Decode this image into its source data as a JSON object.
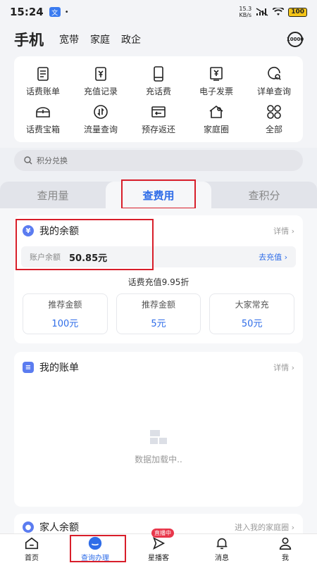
{
  "status": {
    "time": "15:24",
    "app_badge": "文",
    "speed_top": "15.3",
    "speed_bottom": "KB/s",
    "battery": "100"
  },
  "header": {
    "title": "手机",
    "tabs": [
      "宽带",
      "家庭",
      "政企"
    ],
    "right_icon": "10000"
  },
  "grid": [
    {
      "label": "话费账单",
      "icon": "bill-icon"
    },
    {
      "label": "充值记录",
      "icon": "recharge-record-icon"
    },
    {
      "label": "充话费",
      "icon": "phone-recharge-icon"
    },
    {
      "label": "电子发票",
      "icon": "invoice-icon"
    },
    {
      "label": "详单查询",
      "icon": "detail-query-icon"
    },
    {
      "label": "话费宝箱",
      "icon": "treasure-box-icon"
    },
    {
      "label": "流量查询",
      "icon": "data-query-icon"
    },
    {
      "label": "预存返还",
      "icon": "prepay-return-icon"
    },
    {
      "label": "家庭圈",
      "icon": "family-circle-icon"
    },
    {
      "label": "全部",
      "icon": "all-icon"
    }
  ],
  "search": {
    "placeholder": "积分兑换"
  },
  "tabs": [
    "查用量",
    "查费用",
    "查积分"
  ],
  "balance": {
    "title": "我的余额",
    "more": "详情",
    "label": "账户余额",
    "value": "50.85元",
    "recharge": "去充值",
    "promo_title": "话费充值9.95折",
    "options": [
      {
        "label": "推荐金额",
        "value": "100元"
      },
      {
        "label": "推荐金额",
        "value": "5元"
      },
      {
        "label": "大家常充",
        "value": "50元"
      }
    ]
  },
  "bill": {
    "title": "我的账单",
    "more": "详情",
    "loading": "数据加载中.."
  },
  "family": {
    "title": "家人余额",
    "more": "进入我的家庭圈"
  },
  "nav": [
    {
      "label": "首页"
    },
    {
      "label": "查询办理"
    },
    {
      "label": "星播客",
      "badge": "直播中"
    },
    {
      "label": "消息"
    },
    {
      "label": "我"
    }
  ],
  "colors": {
    "accent": "#2f6de8",
    "highlight": "#d81e2a"
  }
}
